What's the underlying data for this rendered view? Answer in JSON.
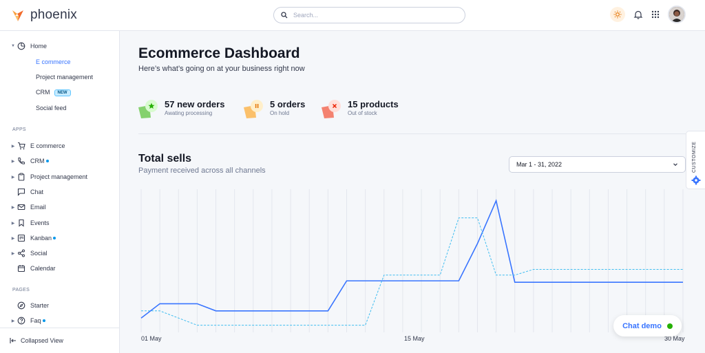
{
  "brand": {
    "name": "phoenix"
  },
  "search": {
    "placeholder": "Search..."
  },
  "sidebar": {
    "home": "Home",
    "home_children": [
      "E commerce",
      "Project management",
      "CRM",
      "Social feed"
    ],
    "new_badge": "NEW",
    "apps_label": "APPS",
    "apps": [
      "E commerce",
      "CRM",
      "Project management",
      "Chat",
      "Email",
      "Events",
      "Kanban",
      "Social",
      "Calendar"
    ],
    "pages_label": "PAGES",
    "pages": [
      "Starter",
      "Faq"
    ],
    "collapse": "Collapsed View"
  },
  "header": {
    "title": "Ecommerce Dashboard",
    "subtitle": "Here’s what’s going on at your business right now"
  },
  "stats": [
    {
      "title": "57 new orders",
      "sub": "Awating processing",
      "color": "#25b003"
    },
    {
      "title": "5 orders",
      "sub": "On hold",
      "color": "#e5780b"
    },
    {
      "title": "15 products",
      "sub": "Out of stock",
      "color": "#ec1f00"
    }
  ],
  "total_sells": {
    "title": "Total sells",
    "subtitle": "Payment received across all channels",
    "date_range": "Mar 1 - 31, 2022"
  },
  "chart_data": {
    "type": "line",
    "x_labels": [
      "01 May",
      "15 May",
      "30 May"
    ],
    "x": [
      1,
      2,
      3,
      4,
      5,
      6,
      7,
      8,
      9,
      10,
      11,
      12,
      13,
      14,
      15,
      16,
      17,
      18,
      19,
      20,
      21,
      22,
      23,
      24,
      25,
      26,
      27,
      28,
      29,
      30
    ],
    "series": [
      {
        "style": "solid",
        "color": "#3874ff",
        "values": [
          10,
          20,
          20,
          20,
          15,
          15,
          15,
          15,
          15,
          15,
          15,
          36,
          36,
          36,
          36,
          36,
          36,
          36,
          62,
          92,
          35,
          35,
          35,
          35,
          35,
          35,
          35,
          35,
          35,
          35
        ]
      },
      {
        "style": "dashed",
        "color": "#3ebcf0",
        "values": [
          15,
          15,
          10,
          5,
          5,
          5,
          5,
          5,
          5,
          5,
          5,
          5,
          5,
          40,
          40,
          40,
          40,
          80,
          80,
          40,
          40,
          44,
          44,
          44,
          44,
          44,
          44,
          44,
          44,
          44
        ]
      }
    ],
    "grid": "vertical"
  },
  "customize": {
    "label": "CUSTOMIZE"
  },
  "chat": {
    "label": "Chat demo"
  }
}
